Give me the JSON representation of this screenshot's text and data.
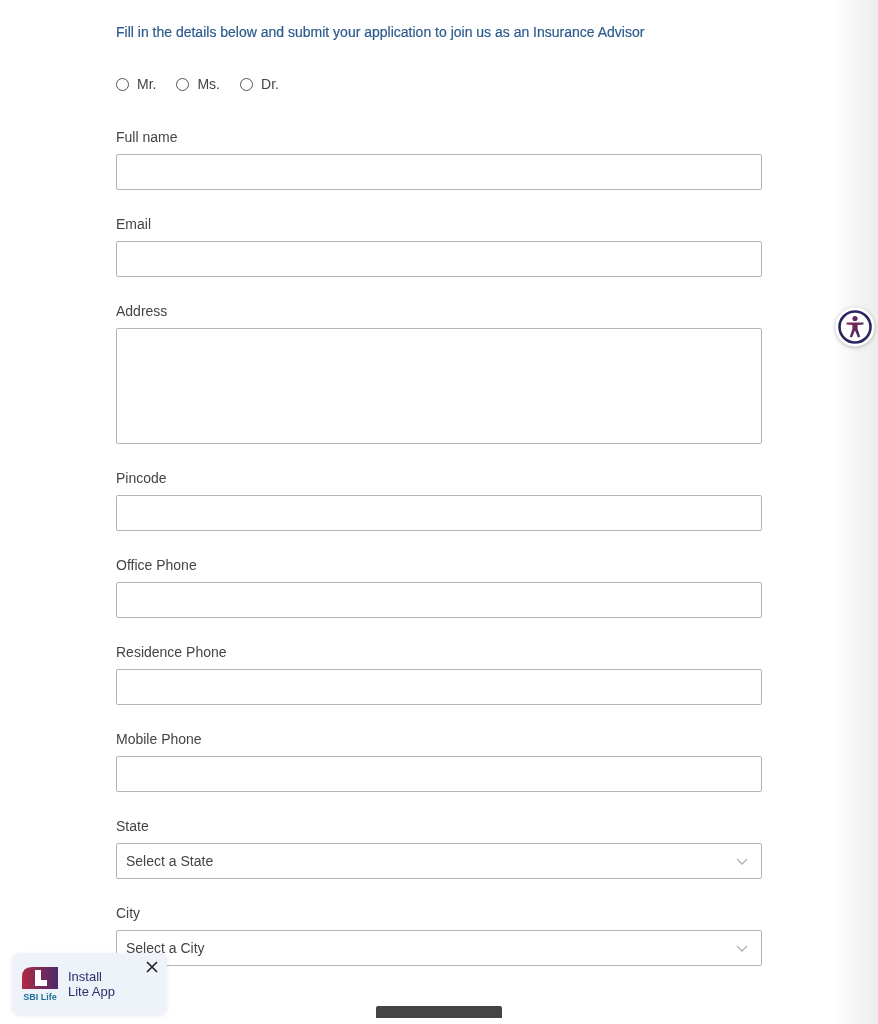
{
  "intro": "Fill in the details below and submit your application to join us as an Insurance Advisor",
  "salutations": [
    {
      "label": "Mr.",
      "selected": false
    },
    {
      "label": "Ms.",
      "selected": false
    },
    {
      "label": "Dr.",
      "selected": false
    }
  ],
  "fields": [
    {
      "label": "Full name",
      "kind": "text"
    },
    {
      "label": "Email",
      "kind": "text"
    },
    {
      "label": "Address",
      "kind": "textarea"
    },
    {
      "label": "Pincode",
      "kind": "text"
    },
    {
      "label": "Office Phone",
      "kind": "text"
    },
    {
      "label": "Residence Phone",
      "kind": "text"
    },
    {
      "label": "Mobile Phone",
      "kind": "text"
    },
    {
      "label": "State",
      "kind": "select",
      "placeholder": "Select a State"
    },
    {
      "label": "City",
      "kind": "select",
      "placeholder": "Select a City"
    }
  ],
  "install_banner": {
    "brand": "SBI Life",
    "text": "Install Lite App"
  }
}
